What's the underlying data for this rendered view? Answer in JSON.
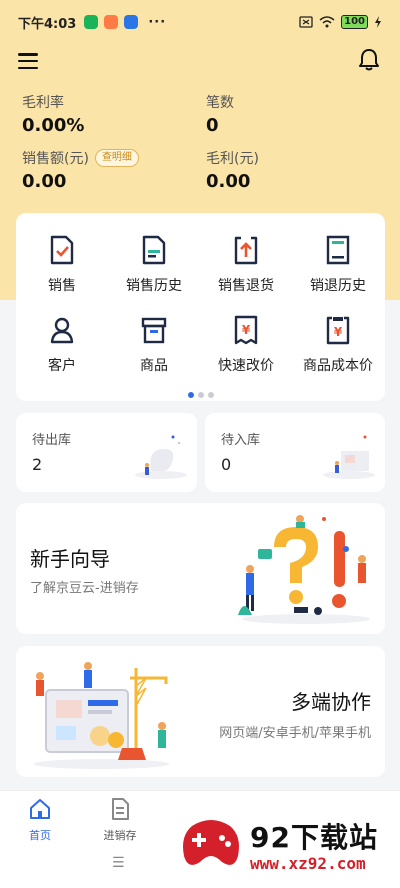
{
  "status_bar": {
    "time": "下午4:03",
    "dots": "···",
    "battery": "100"
  },
  "stats": {
    "gross_rate": {
      "label": "毛利率",
      "value": "0.00%"
    },
    "count": {
      "label": "笔数",
      "value": "0"
    },
    "sales_amount": {
      "label": "销售额(元)",
      "value": "0.00",
      "badge": "查明细"
    },
    "gross_profit": {
      "label": "毛利(元)",
      "value": "0.00"
    }
  },
  "quick_menu": {
    "items": [
      {
        "label": "销售",
        "icon": "sales-doc-icon"
      },
      {
        "label": "销售历史",
        "icon": "sales-history-icon"
      },
      {
        "label": "销售退货",
        "icon": "sales-return-icon"
      },
      {
        "label": "销退历史",
        "icon": "return-history-icon"
      },
      {
        "label": "客户",
        "icon": "customer-icon"
      },
      {
        "label": "商品",
        "icon": "product-box-icon"
      },
      {
        "label": "快速改价",
        "icon": "quick-price-icon"
      },
      {
        "label": "商品成本价",
        "icon": "cost-price-icon"
      }
    ],
    "page_count": 3,
    "active_page": 1
  },
  "stock": {
    "outbound": {
      "title": "待出库",
      "value": "2"
    },
    "inbound": {
      "title": "待入库",
      "value": "0"
    }
  },
  "guide_card": {
    "title": "新手向导",
    "subtitle": "了解京豆云-进销存"
  },
  "multi_card": {
    "title": "多端协作",
    "subtitle": "网页端/安卓手机/苹果手机"
  },
  "tabbar": {
    "home": "首页",
    "inventory": "进销存"
  },
  "watermark": {
    "title": "92下载站",
    "url": "www.xz92.com"
  },
  "colors": {
    "header_bg": "#fbe4a8",
    "accent_red": "#e8552f",
    "accent_blue": "#2f6be8",
    "icon_dark": "#1f2a44"
  }
}
